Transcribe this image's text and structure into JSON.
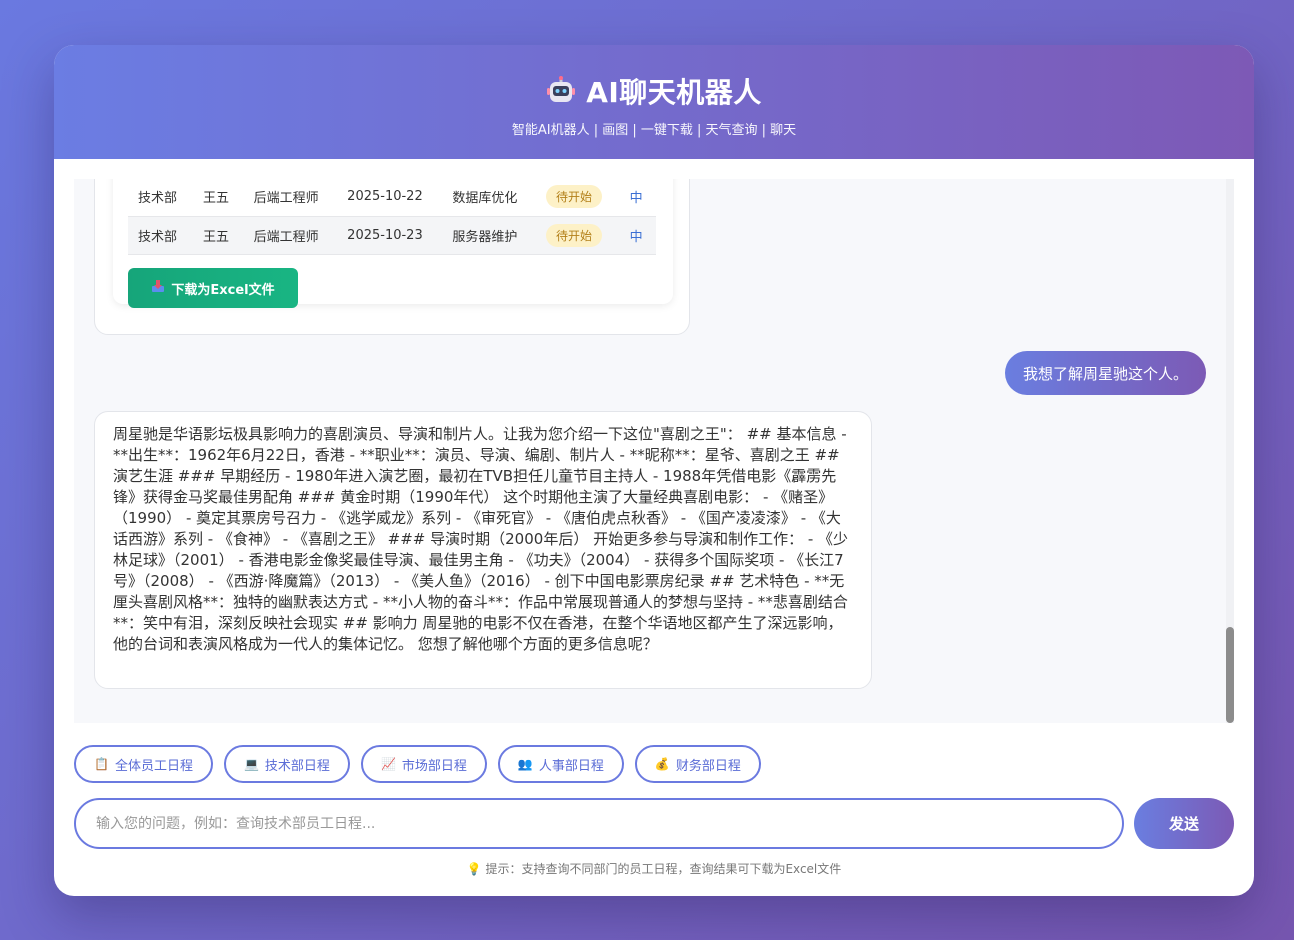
{
  "header": {
    "title": "AI聊天机器人",
    "subtitle": "智能AI机器人 | 画图 | 一键下载 | 天气查询 | 聊天"
  },
  "schedule_table": {
    "rows": [
      {
        "dept": "技术部",
        "name": "王五",
        "role": "后端工程师",
        "date": "2025-10-22",
        "task": "数据库优化",
        "status": "待开始",
        "priority": "中"
      },
      {
        "dept": "技术部",
        "name": "王五",
        "role": "后端工程师",
        "date": "2025-10-23",
        "task": "服务器维护",
        "status": "待开始",
        "priority": "中"
      }
    ],
    "download_label": "下载为Excel文件"
  },
  "messages": {
    "user_message": "我想了解周星驰这个人。",
    "bot_reply": "周星驰是华语影坛极具影响力的喜剧演员、导演和制片人。让我为您介绍一下这位\"喜剧之王\"： ## 基本信息 - **出生**：1962年6月22日，香港 - **职业**：演员、导演、编剧、制片人 - **昵称**：星爷、喜剧之王 ## 演艺生涯 ### 早期经历 - 1980年进入演艺圈，最初在TVB担任儿童节目主持人 - 1988年凭借电影《霹雳先锋》获得金马奖最佳男配角 ### 黄金时期（1990年代） 这个时期他主演了大量经典喜剧电影： - 《赌圣》（1990） - 奠定其票房号召力 - 《逃学威龙》系列 - 《审死官》 - 《唐伯虎点秋香》 - 《国产凌凌漆》 - 《大话西游》系列 - 《食神》 - 《喜剧之王》 ### 导演时期（2000年后） 开始更多参与导演和制作工作： - 《少林足球》（2001） - 香港电影金像奖最佳导演、最佳男主角 - 《功夫》（2004） - 获得多个国际奖项 - 《长江7号》（2008） - 《西游·降魔篇》（2013） - 《美人鱼》（2016） - 创下中国电影票房纪录 ## 艺术特色 - **无厘头喜剧风格**：独特的幽默表达方式 - **小人物的奋斗**：作品中常展现普通人的梦想与坚持 - **悲喜剧结合**：笑中有泪，深刻反映社会现实 ## 影响力 周星驰的电影不仅在香港，在整个华语地区都产生了深远影响，他的台词和表演风格成为一代人的集体记忆。 您想了解他哪个方面的更多信息呢？"
  },
  "quick_actions": [
    {
      "icon": "📋",
      "label": "全体员工日程"
    },
    {
      "icon": "💻",
      "label": "技术部日程"
    },
    {
      "icon": "📈",
      "label": "市场部日程"
    },
    {
      "icon": "👥",
      "label": "人事部日程"
    },
    {
      "icon": "💰",
      "label": "财务部日程"
    }
  ],
  "input": {
    "placeholder": "输入您的问题，例如：查询技术部员工日程...",
    "value": ""
  },
  "send_label": "发送",
  "hint": "💡 提示：支持查询不同部门的员工日程，查询结果可下载为Excel文件",
  "colors": {
    "accent_start": "#6a7ee0",
    "accent_end": "#7c5ab5",
    "download_green": "#16a57a",
    "status_bg": "#fdf1c7"
  }
}
